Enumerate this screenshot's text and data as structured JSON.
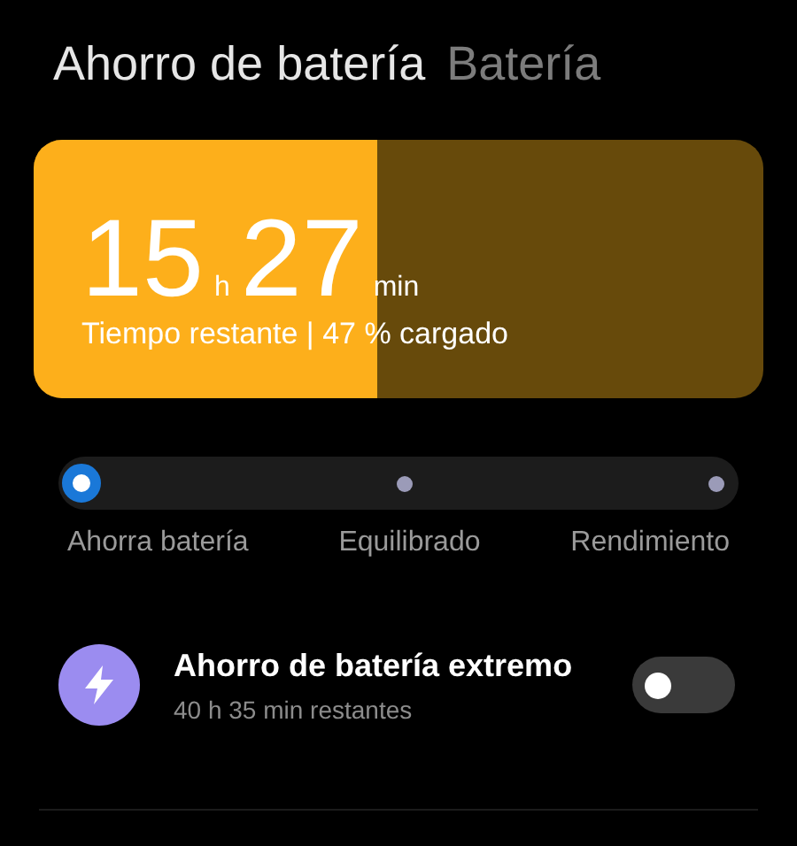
{
  "tabs": [
    {
      "label": "Ahorro de batería",
      "selected": true
    },
    {
      "label": "Batería",
      "selected": false
    }
  ],
  "battery": {
    "level": 0.47,
    "hours": "15",
    "hours_unit": "h",
    "minutes": "27",
    "minutes_unit": "min",
    "caption": "Tiempo restante | 47 % cargado"
  },
  "modes": [
    {
      "label": "Ahorra batería",
      "selected": true
    },
    {
      "label": "Equilibrado",
      "selected": false
    },
    {
      "label": "Rendimiento",
      "selected": false
    }
  ],
  "extreme": {
    "title": "Ahorro de batería extremo",
    "subtitle": "40 h 35 min restantes",
    "on": false
  }
}
